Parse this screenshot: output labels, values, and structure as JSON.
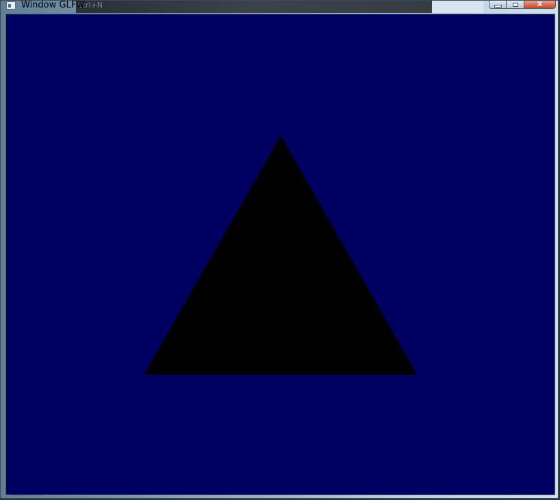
{
  "window": {
    "title": "Window GLFW",
    "background_title_ghost": "Ctrl+N",
    "controls": {
      "minimize_icon": "minimize-icon",
      "maximize_icon": "maximize-icon",
      "close_symbol": "X"
    }
  },
  "canvas": {
    "clear_color": "#000060",
    "triangle_color": "#000000"
  }
}
